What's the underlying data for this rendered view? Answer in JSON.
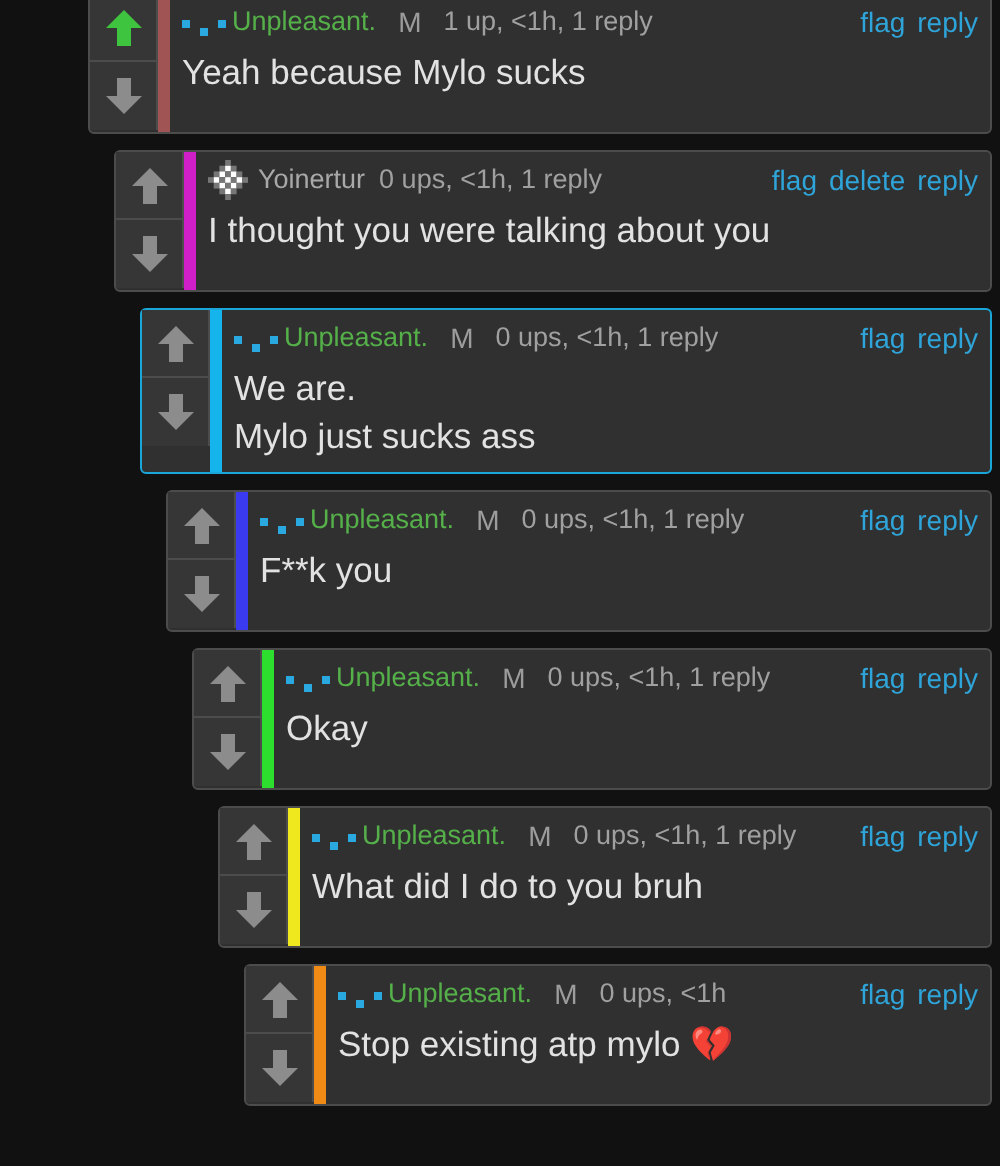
{
  "thread": [
    {
      "user": {
        "name": "Unpleasant.",
        "color": "#55b04a"
      },
      "avatar": {
        "kind": "dots"
      },
      "badge": "M",
      "meta": "1 up, <1h, 1 reply",
      "actions": [
        "flag",
        "reply"
      ],
      "text": "Yeah because Mylo sucks",
      "color": "#a05454",
      "upvoted": true,
      "highlighted": false,
      "children": [
        {
          "user": {
            "name": "Yoinertur",
            "color": "#a8a8a8"
          },
          "avatar": {
            "kind": "checker"
          },
          "meta": "0 ups, <1h, 1 reply",
          "actions": [
            "flag",
            "delete",
            "reply"
          ],
          "text": "I thought you were talking about you",
          "color": "#d01ec8",
          "upvoted": false,
          "highlighted": false,
          "children": [
            {
              "user": {
                "name": "Unpleasant.",
                "color": "#55b04a"
              },
              "avatar": {
                "kind": "dots"
              },
              "badge": "M",
              "meta": "0 ups, <1h, 1 reply",
              "actions": [
                "flag",
                "reply"
              ],
              "text": "We are.\nMylo just sucks ass",
              "color": "#16b4ec",
              "upvoted": false,
              "highlighted": true,
              "children": [
                {
                  "user": {
                    "name": "Unpleasant.",
                    "color": "#55b04a"
                  },
                  "avatar": {
                    "kind": "dots"
                  },
                  "badge": "M",
                  "meta": "0 ups, <1h, 1 reply",
                  "actions": [
                    "flag",
                    "reply"
                  ],
                  "text": "F**k you",
                  "color": "#3a3af0",
                  "upvoted": false,
                  "highlighted": false,
                  "children": [
                    {
                      "user": {
                        "name": "Unpleasant.",
                        "color": "#55b04a"
                      },
                      "avatar": {
                        "kind": "dots"
                      },
                      "badge": "M",
                      "meta": "0 ups, <1h, 1 reply",
                      "actions": [
                        "flag",
                        "reply"
                      ],
                      "text": "Okay",
                      "color": "#2ede2e",
                      "upvoted": false,
                      "highlighted": false,
                      "children": [
                        {
                          "user": {
                            "name": "Unpleasant.",
                            "color": "#55b04a"
                          },
                          "avatar": {
                            "kind": "dots"
                          },
                          "badge": "M",
                          "meta": "0 ups, <1h, 1 reply",
                          "actions": [
                            "flag",
                            "reply"
                          ],
                          "text": "What did I do to you bruh",
                          "color": "#f0e81e",
                          "upvoted": false,
                          "highlighted": false,
                          "children": [
                            {
                              "user": {
                                "name": "Unpleasant.",
                                "color": "#55b04a"
                              },
                              "avatar": {
                                "kind": "dots"
                              },
                              "badge": "M",
                              "meta": "0 ups, <1h",
                              "actions": [
                                "flag",
                                "reply"
                              ],
                              "text": "Stop existing atp mylo 💔",
                              "color": "#f08a14",
                              "upvoted": false,
                              "highlighted": false
                            }
                          ]
                        }
                      ]
                    }
                  ]
                }
              ]
            }
          ]
        }
      ]
    }
  ]
}
